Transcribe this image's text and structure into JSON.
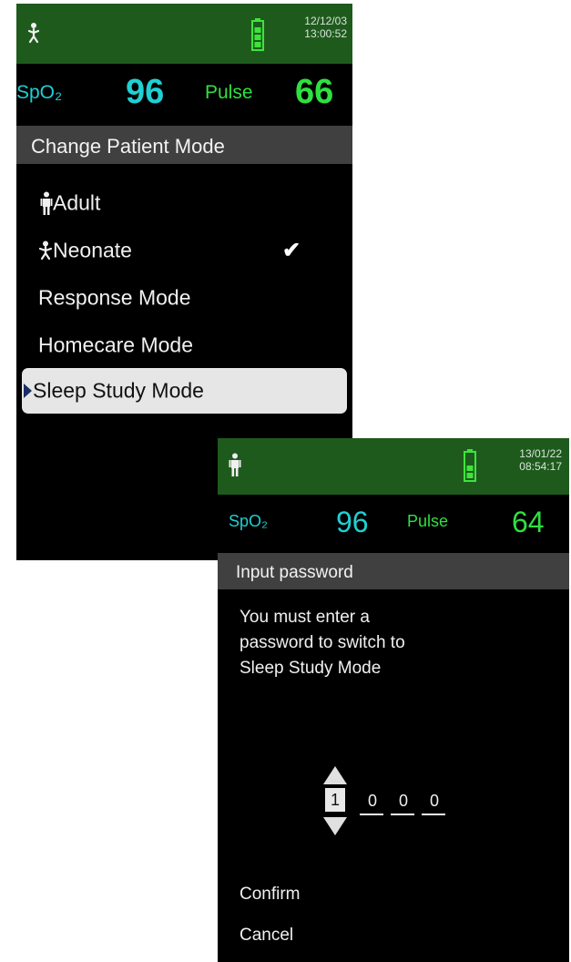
{
  "screen1": {
    "header": {
      "patient_icon": "neonate-icon",
      "battery_icon": "battery-icon",
      "date": "12/12/03",
      "time": "13:00:52"
    },
    "vitals": {
      "spo2_label": "SpO₂",
      "spo2_value": "96",
      "pulse_label": "Pulse",
      "pulse_value": "66"
    },
    "title": "Change Patient Mode",
    "menu": [
      {
        "icon": "adult-icon",
        "label": "Adult",
        "checked": false
      },
      {
        "icon": "neonate-icon",
        "label": "Neonate",
        "checked": true
      },
      {
        "label": "Response Mode",
        "checked": false
      },
      {
        "label": "Homecare Mode",
        "checked": false
      },
      {
        "label": "Sleep Study Mode",
        "selected": true
      }
    ]
  },
  "screen2": {
    "header": {
      "patient_icon": "adult-icon",
      "battery_icon": "battery-icon",
      "date": "13/01/22",
      "time": "08:54:17"
    },
    "vitals": {
      "spo2_label": "SpO₂",
      "spo2_value": "96",
      "pulse_label": "Pulse",
      "pulse_value": "64"
    },
    "title": "Input password",
    "message": [
      "You must enter a",
      "password to switch to",
      "Sleep Study Mode"
    ],
    "password_digits": [
      "1",
      "0",
      "0",
      "0"
    ],
    "confirm_label": "Confirm",
    "cancel_label": "Cancel"
  },
  "colors": {
    "header_bg": "#1f5a1d",
    "spo2": "#1fd0d4",
    "pulse": "#2ee040",
    "titlebar_bg": "#3f403f",
    "battery": "#3ce43c"
  }
}
